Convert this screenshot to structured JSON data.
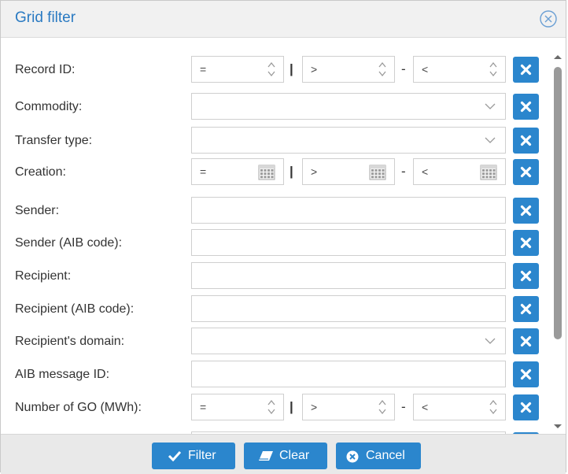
{
  "dialog": {
    "title": "Grid filter",
    "close_icon": "close-circle-icon"
  },
  "fields": [
    {
      "label": "Record ID:",
      "type": "range-number",
      "op1": "=",
      "op2": ">",
      "op3": "<"
    },
    {
      "label": "Commodity:",
      "type": "select",
      "value": ""
    },
    {
      "label": "Transfer type:",
      "type": "select",
      "value": ""
    },
    {
      "label": "Creation:",
      "type": "range-date",
      "op1": "=",
      "op2": ">",
      "op3": "<"
    },
    {
      "label": "Sender:",
      "type": "text",
      "value": ""
    },
    {
      "label": "Sender (AIB code):",
      "type": "text",
      "value": ""
    },
    {
      "label": "Recipient:",
      "type": "text",
      "value": ""
    },
    {
      "label": "Recipient (AIB code):",
      "type": "text",
      "value": ""
    },
    {
      "label": "Recipient's domain:",
      "type": "select",
      "value": ""
    },
    {
      "label": "AIB message ID:",
      "type": "text",
      "value": ""
    },
    {
      "label": "Number of GO (MWh):",
      "type": "range-number",
      "op1": "=",
      "op2": ">",
      "op3": "<"
    }
  ],
  "separators": {
    "between": "|",
    "dash": "-"
  },
  "footer": {
    "filter_label": "Filter",
    "clear_label": "Clear",
    "cancel_label": "Cancel"
  },
  "colors": {
    "accent": "#2b86cd",
    "title": "#2a7ac2"
  }
}
